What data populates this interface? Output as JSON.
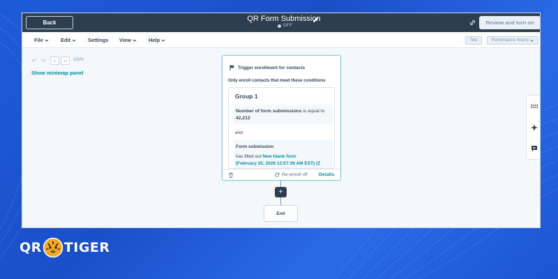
{
  "header": {
    "back_label": "Back",
    "title": "QR Form Submission",
    "status": "OFF",
    "review_label": "Review and turn on"
  },
  "menu": {
    "items": [
      {
        "label": "File",
        "dropdown": true
      },
      {
        "label": "Edit",
        "dropdown": true
      },
      {
        "label": "Settings",
        "dropdown": false
      },
      {
        "label": "View",
        "dropdown": true
      },
      {
        "label": "Help",
        "dropdown": true
      }
    ],
    "test_label": "Test",
    "performance_label": "Performance history"
  },
  "canvas": {
    "undo": "↶",
    "redo": "↷",
    "zoom_in": "+",
    "zoom_out": "−",
    "zoom_level": "100%",
    "minimap_label": "Show minimap panel"
  },
  "trigger": {
    "title": "Trigger enrollment for contacts",
    "subtitle": "Only enroll contacts that meet these conditions",
    "group_title": "Group 1",
    "condition1": {
      "property": "Number of form submissions",
      "operator": "is equal to",
      "value": "42,212"
    },
    "and_label": "and",
    "condition2": {
      "title": "Form submission",
      "text": "has filled out",
      "form_name": "New blank form",
      "date": "(February 25, 2026 12:57:39 AM EST)"
    },
    "reenroll_label": "Re-enroll off",
    "details_label": "Details"
  },
  "flow": {
    "add_label": "+",
    "end_label": "End"
  },
  "logo": {
    "left": "QR",
    "right": "TIGER"
  },
  "colors": {
    "header_bg": "#2d3e50",
    "accent": "#0091ae",
    "background": "#1e5bd8"
  }
}
